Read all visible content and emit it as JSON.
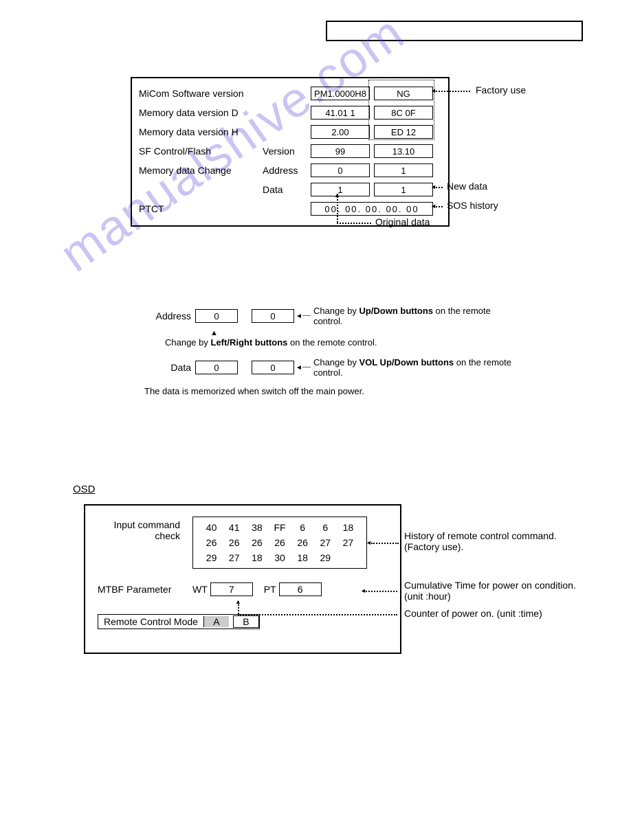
{
  "panel1": {
    "rows": [
      {
        "label": "MiCom Software version",
        "sub": "",
        "v1": "PM1.0000H8",
        "v2": "NG"
      },
      {
        "label": "Memory data version D",
        "sub": "",
        "v1": "41.01  1",
        "v2": "8C 0F"
      },
      {
        "label": "Memory data version H",
        "sub": "",
        "v1": "2.00",
        "v2": "ED 12"
      },
      {
        "label": "SF Control/Flash",
        "sub": "Version",
        "v1": "99",
        "v2": "13.10"
      },
      {
        "label": "Memory data Change",
        "sub": "Address",
        "v1": "0",
        "v2": "1"
      },
      {
        "label": "",
        "sub": "Data",
        "v1": "1",
        "v2": "1"
      },
      {
        "label": "PTCT",
        "sub": "",
        "wide": "00. 00. 00. 00. 00"
      }
    ],
    "annot": {
      "factory": "Factory use",
      "newdata": "New data",
      "sos": "SOS history",
      "orig": "Original data"
    }
  },
  "sec2": {
    "addr_label": "Address",
    "data_label": "Data",
    "addr_v1": "0",
    "addr_v2": "0",
    "data_v1": "0",
    "data_v2": "0",
    "addr_desc_pre": "Change by ",
    "addr_desc_bold": "Up/Down buttons",
    "addr_desc_post": " on the remote control.",
    "addr_below_pre": "Change by ",
    "addr_below_bold": "Left/Right buttons",
    "addr_below_post": " on the remote control.",
    "data_desc_pre": "Change by ",
    "data_desc_bold": "VOL Up/Down buttons",
    "data_desc_post": " on the remote control.",
    "note": "The data is memorized when switch off the main power."
  },
  "watermark": "manualshive.com",
  "osd": {
    "title": "OSD",
    "icc_label1": "Input command",
    "icc_label2": "check",
    "hex": [
      [
        "40",
        "41",
        "38",
        "FF",
        "6",
        "6",
        "18"
      ],
      [
        "26",
        "26",
        "26",
        "26",
        "26",
        "27",
        "27"
      ],
      [
        "29",
        "27",
        "18",
        "30",
        "18",
        "29",
        ""
      ]
    ],
    "mtbf_label": "MTBF Parameter",
    "wt_label": "WT",
    "wt_val": "7",
    "pt_label": "PT",
    "pt_val": "6",
    "rcm_label": "Remote Control Mode",
    "rcm_a": "A",
    "rcm_b": "B",
    "annot": {
      "history": "History of remote control command. (Factory use).",
      "cumtime": "Cumulative Time for power on condition. (unit :hour)",
      "counter": "Counter of power on. (unit :time)"
    }
  }
}
